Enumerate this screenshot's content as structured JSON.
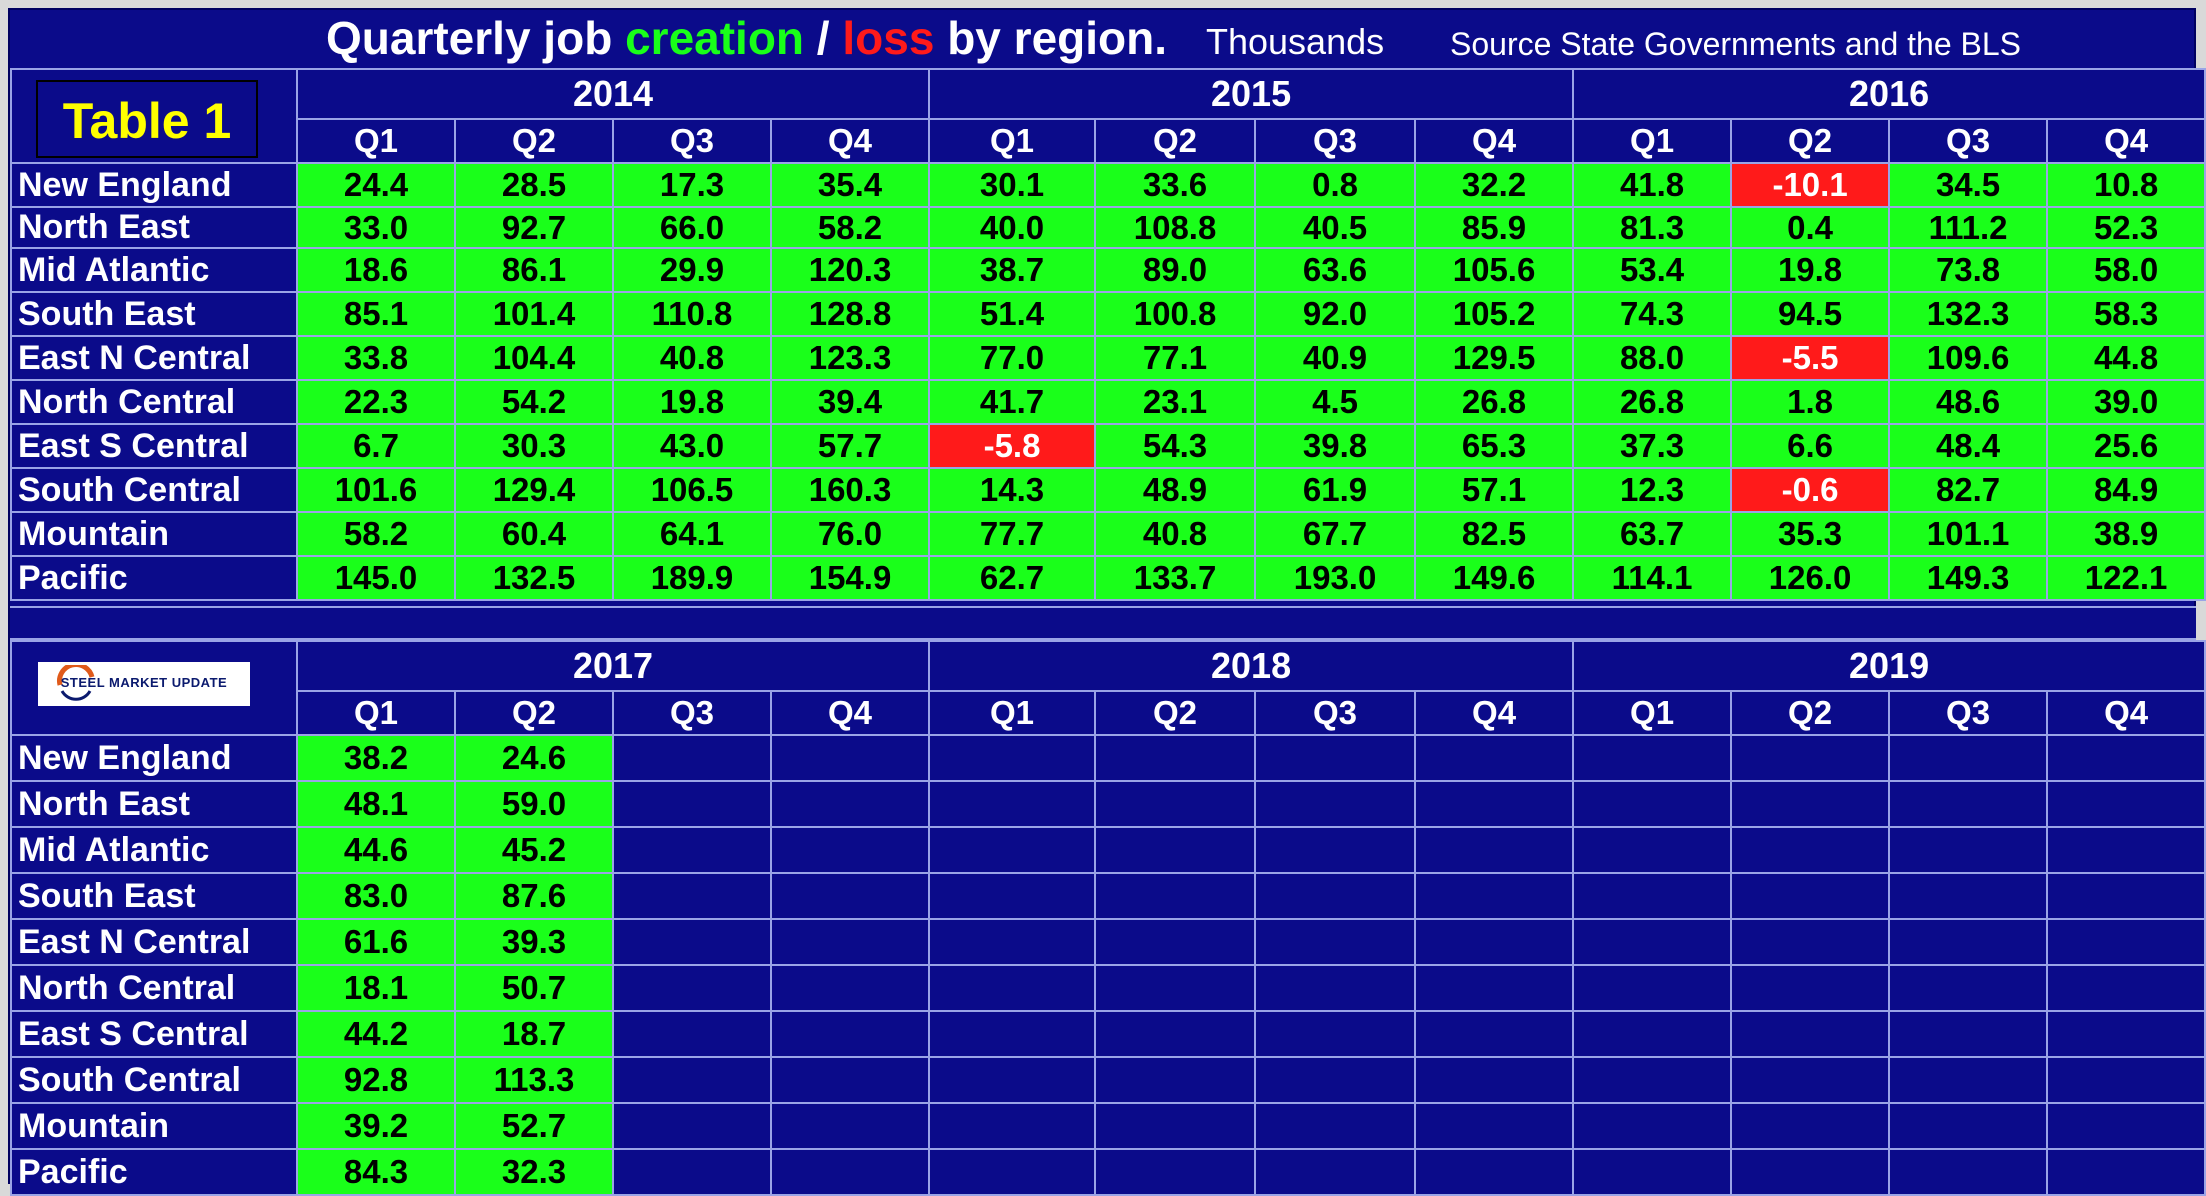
{
  "title": {
    "part1": "Quarterly job ",
    "creation": "creation",
    "slash": " / ",
    "loss": "loss",
    "part2": " by region.",
    "unit": "Thousands",
    "source": "Source State Governments and the BLS"
  },
  "table_label": "Table 1",
  "logo_text": "STEEL MARKET UPDATE",
  "colors": {
    "positive": "#1aff1a",
    "negative": "#ff1a1a",
    "background": "#0b0b8a",
    "label": "#ffff00"
  },
  "quarters": [
    "Q1",
    "Q2",
    "Q3",
    "Q4"
  ],
  "top_table": {
    "years": [
      "2014",
      "2015",
      "2016"
    ],
    "rows": [
      {
        "region": "New England",
        "values": [
          "24.4",
          "28.5",
          "17.3",
          "35.4",
          "30.1",
          "33.6",
          "0.8",
          "32.2",
          "41.8",
          "-10.1",
          "34.5",
          "10.8"
        ]
      },
      {
        "region": "North East",
        "values": [
          "33.0",
          "92.7",
          "66.0",
          "58.2",
          "40.0",
          "108.8",
          "40.5",
          "85.9",
          "81.3",
          "0.4",
          "111.2",
          "52.3"
        ]
      },
      {
        "region": "Mid Atlantic",
        "values": [
          "18.6",
          "86.1",
          "29.9",
          "120.3",
          "38.7",
          "89.0",
          "63.6",
          "105.6",
          "53.4",
          "19.8",
          "73.8",
          "58.0"
        ]
      },
      {
        "region": "South East",
        "values": [
          "85.1",
          "101.4",
          "110.8",
          "128.8",
          "51.4",
          "100.8",
          "92.0",
          "105.2",
          "74.3",
          "94.5",
          "132.3",
          "58.3"
        ]
      },
      {
        "region": "East N Central",
        "values": [
          "33.8",
          "104.4",
          "40.8",
          "123.3",
          "77.0",
          "77.1",
          "40.9",
          "129.5",
          "88.0",
          "-5.5",
          "109.6",
          "44.8"
        ]
      },
      {
        "region": "North Central",
        "values": [
          "22.3",
          "54.2",
          "19.8",
          "39.4",
          "41.7",
          "23.1",
          "4.5",
          "26.8",
          "26.8",
          "1.8",
          "48.6",
          "39.0"
        ]
      },
      {
        "region": "East S Central",
        "values": [
          "6.7",
          "30.3",
          "43.0",
          "57.7",
          "-5.8",
          "54.3",
          "39.8",
          "65.3",
          "37.3",
          "6.6",
          "48.4",
          "25.6"
        ]
      },
      {
        "region": "South Central",
        "values": [
          "101.6",
          "129.4",
          "106.5",
          "160.3",
          "14.3",
          "48.9",
          "61.9",
          "57.1",
          "12.3",
          "-0.6",
          "82.7",
          "84.9"
        ]
      },
      {
        "region": "Mountain",
        "values": [
          "58.2",
          "60.4",
          "64.1",
          "76.0",
          "77.7",
          "40.8",
          "67.7",
          "82.5",
          "63.7",
          "35.3",
          "101.1",
          "38.9"
        ]
      },
      {
        "region": "Pacific",
        "values": [
          "145.0",
          "132.5",
          "189.9",
          "154.9",
          "62.7",
          "133.7",
          "193.0",
          "149.6",
          "114.1",
          "126.0",
          "149.3",
          "122.1"
        ]
      }
    ]
  },
  "bottom_table": {
    "years": [
      "2017",
      "2018",
      "2019"
    ],
    "rows": [
      {
        "region": "New England",
        "values": [
          "38.2",
          "24.6",
          "",
          "",
          "",
          "",
          "",
          "",
          "",
          "",
          "",
          ""
        ]
      },
      {
        "region": "North East",
        "values": [
          "48.1",
          "59.0",
          "",
          "",
          "",
          "",
          "",
          "",
          "",
          "",
          "",
          ""
        ]
      },
      {
        "region": "Mid Atlantic",
        "values": [
          "44.6",
          "45.2",
          "",
          "",
          "",
          "",
          "",
          "",
          "",
          "",
          "",
          ""
        ]
      },
      {
        "region": "South East",
        "values": [
          "83.0",
          "87.6",
          "",
          "",
          "",
          "",
          "",
          "",
          "",
          "",
          "",
          ""
        ]
      },
      {
        "region": "East N Central",
        "values": [
          "61.6",
          "39.3",
          "",
          "",
          "",
          "",
          "",
          "",
          "",
          "",
          "",
          ""
        ]
      },
      {
        "region": "North Central",
        "values": [
          "18.1",
          "50.7",
          "",
          "",
          "",
          "",
          "",
          "",
          "",
          "",
          "",
          ""
        ]
      },
      {
        "region": "East S Central",
        "values": [
          "44.2",
          "18.7",
          "",
          "",
          "",
          "",
          "",
          "",
          "",
          "",
          "",
          ""
        ]
      },
      {
        "region": "South Central",
        "values": [
          "92.8",
          "113.3",
          "",
          "",
          "",
          "",
          "",
          "",
          "",
          "",
          "",
          ""
        ]
      },
      {
        "region": "Mountain",
        "values": [
          "39.2",
          "52.7",
          "",
          "",
          "",
          "",
          "",
          "",
          "",
          "",
          "",
          ""
        ]
      },
      {
        "region": "Pacific",
        "values": [
          "84.3",
          "32.3",
          "",
          "",
          "",
          "",
          "",
          "",
          "",
          "",
          "",
          ""
        ]
      }
    ]
  }
}
